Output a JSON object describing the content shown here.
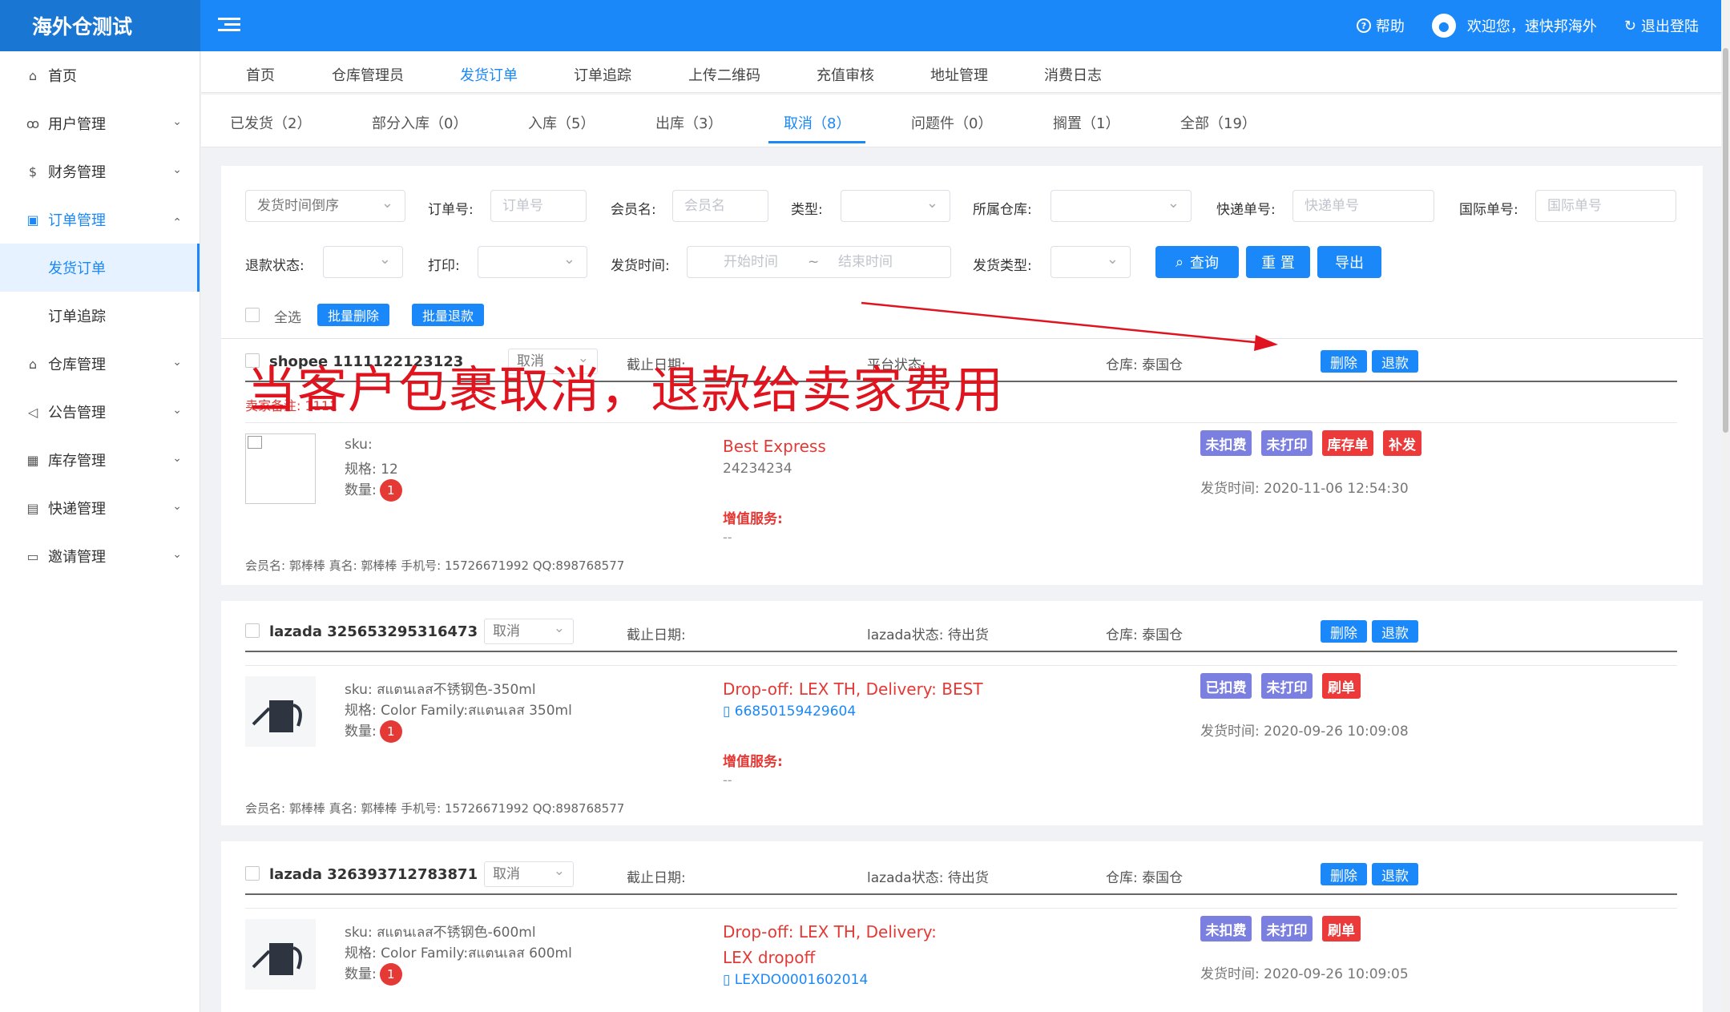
{
  "app": {
    "logo": "海外仓测试",
    "help": "帮助",
    "welcome": "欢迎您，速快邦海外",
    "logout": "退出登陆"
  },
  "sidebar": [
    {
      "label": "首页",
      "icon": "home-icon"
    },
    {
      "label": "用户管理",
      "icon": "user-icon"
    },
    {
      "label": "财务管理",
      "icon": "finance-icon"
    },
    {
      "label": "订单管理",
      "icon": "order-icon"
    },
    {
      "label": "发货订单"
    },
    {
      "label": "订单追踪"
    },
    {
      "label": "仓库管理",
      "icon": "warehouse-icon"
    },
    {
      "label": "公告管理",
      "icon": "announcement-icon"
    },
    {
      "label": "库存管理",
      "icon": "inventory-icon"
    },
    {
      "label": "快递管理",
      "icon": "express-icon"
    },
    {
      "label": "邀请管理",
      "icon": "invite-icon"
    }
  ],
  "nav": [
    "首页",
    "仓库管理员",
    "发货订单",
    "订单追踪",
    "上传二维码",
    "充值审核",
    "地址管理",
    "消费日志"
  ],
  "tabs": [
    "已发货（2）",
    "部分入库（0）",
    "入库（5）",
    "出库（3）",
    "取消（8）",
    "问题件（0）",
    "搁置（1）",
    "全部（19）"
  ],
  "filters": {
    "sort": "发货时间倒序",
    "order_no_label": "订单号:",
    "order_no_ph": "订单号",
    "member_label": "会员名:",
    "member_ph": "会员名",
    "type_label": "类型:",
    "warehouse_label": "所属仓库:",
    "express_label": "快递单号:",
    "express_ph": "快递单号",
    "intl_label": "国际单号:",
    "intl_ph": "国际单号",
    "refund_label": "退款状态:",
    "print_label": "打印:",
    "time_label": "发货时间:",
    "start_ph": "开始时间",
    "tilde": "~",
    "end_ph": "结束时间",
    "ship_type_label": "发货类型:",
    "search": "查询",
    "reset": "重 置",
    "export": "导出"
  },
  "bulk": {
    "select_all": "全选",
    "delete": "批量删除",
    "refund": "批量退款"
  },
  "overlay_text": "当客户包裹取消，退款给卖家费用",
  "orders": [
    {
      "no": "shopee 1111122123123",
      "status": "取消",
      "deadline": "截止日期:",
      "platform_status": "平台状态:",
      "warehouse": "仓库: 泰国仓",
      "remark": "卖家备注: 1111",
      "sku": "sku:",
      "spec": "规格: 12",
      "qty_label": "数量:",
      "qty": "1",
      "express": "Best Express",
      "tracking": "24234234",
      "vas": "增值服务:",
      "vas_val": "--",
      "tags": [
        "未扣费",
        "未打印",
        "库存单",
        "补发"
      ],
      "time": "发货时间: 2020-11-06 12:54:30",
      "meta": "会员名: 郭棒棒    真名: 郭棒棒  手机号: 15726671992   QQ:898768577"
    },
    {
      "no": "lazada 325653295316473",
      "status": "取消",
      "deadline": "截止日期:",
      "platform_status": "lazada状态: 待出货",
      "warehouse": "仓库: 泰国仓",
      "sku": "sku: สแตนเลส不锈钢色-350ml",
      "spec": "规格: Color Family:สแตนเลส 350ml",
      "qty_label": "数量:",
      "qty": "1",
      "express": "Drop-off: LEX TH, Delivery: BEST",
      "tracking": "66850159429604",
      "vas": "增值服务:",
      "vas_val": "--",
      "tags": [
        "已扣费",
        "未打印",
        "刷单"
      ],
      "time": "发货时间: 2020-09-26 10:09:08",
      "meta": "会员名: 郭棒棒    真名: 郭棒棒  手机号: 15726671992   QQ:898768577"
    },
    {
      "no": "lazada 326393712783871",
      "status": "取消",
      "deadline": "截止日期:",
      "platform_status": "lazada状态: 待出货",
      "warehouse": "仓库: 泰国仓",
      "sku": "sku: สแตนเลส不锈钢色-600ml",
      "spec": "规格: Color Family:สแตนเลส 600ml",
      "qty_label": "数量:",
      "qty": "1",
      "express": "Drop-off: LEX TH, Delivery: LEX dropoff",
      "tracking": "LEXDO0001602014",
      "tags": [
        "未扣费",
        "未打印",
        "刷单"
      ],
      "time": "发货时间: 2020-09-26 10:09:05"
    }
  ],
  "actions": {
    "delete": "删除",
    "refund": "退款"
  },
  "colors": {
    "primary": "#1a88f8",
    "danger": "#ec3a3a",
    "tag_purple": "#7b7fdf"
  }
}
